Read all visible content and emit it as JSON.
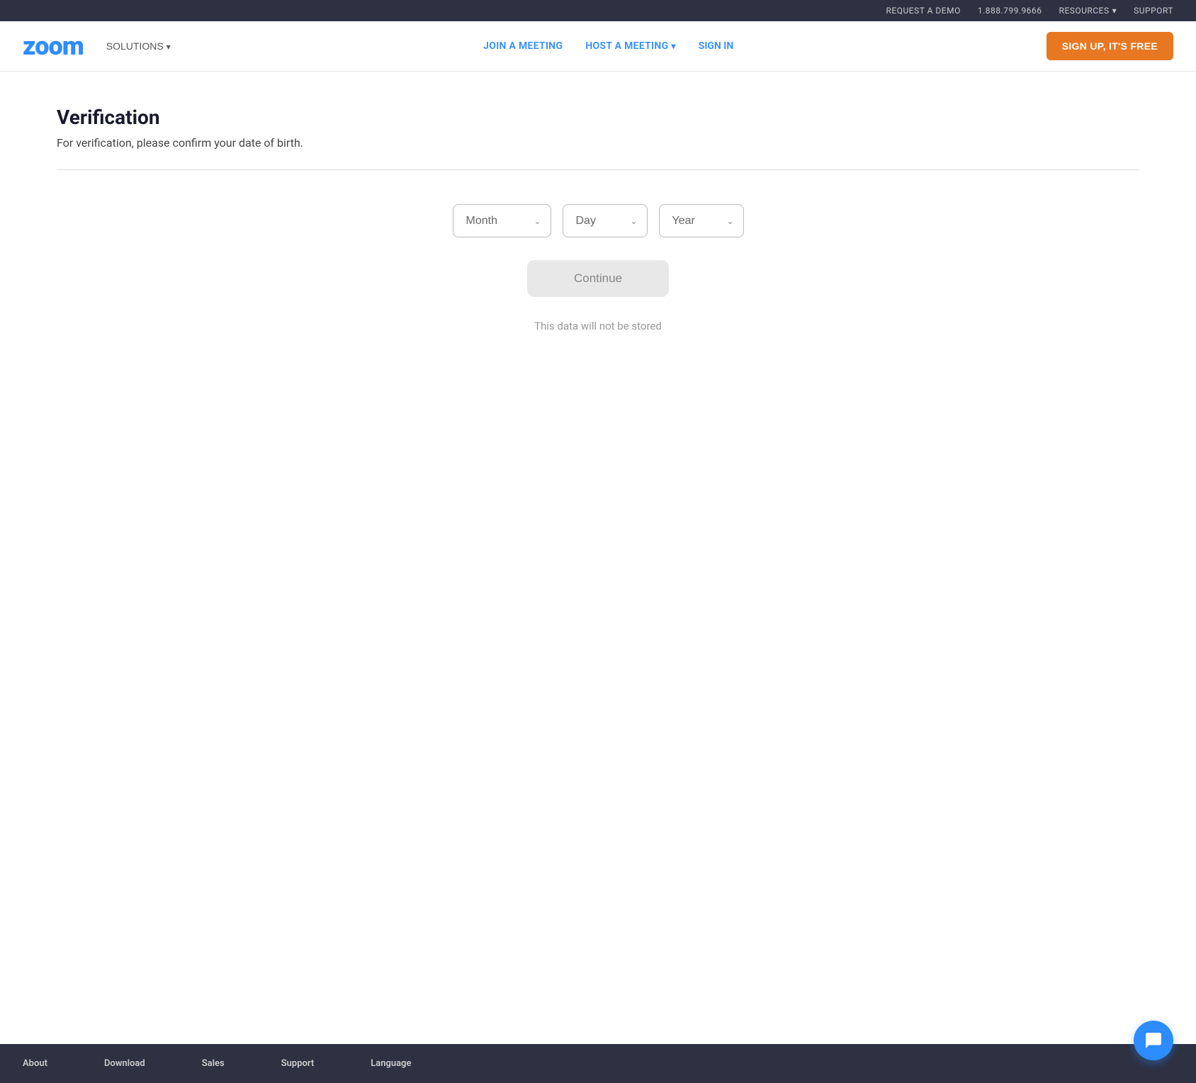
{
  "topBar": {
    "requestDemo": "REQUEST A DEMO",
    "phone": "1.888.799.9666",
    "resources": "RESOURCES",
    "support": "SUPPORT"
  },
  "nav": {
    "logo": "zoom",
    "solutions": "SOLUTIONS",
    "joinMeeting": "JOIN A MEETING",
    "hostMeeting": "HOST A MEETING",
    "signIn": "SIGN IN",
    "signUp": "SIGN UP, IT'S FREE"
  },
  "page": {
    "title": "Verification",
    "subtitle": "For verification, please confirm your date of birth."
  },
  "form": {
    "monthPlaceholder": "Month",
    "dayPlaceholder": "Day",
    "yearPlaceholder": "Year",
    "continueLabel": "Continue",
    "dataNotice": "This data will not be stored"
  },
  "footer": {
    "about": "About",
    "download": "Download",
    "sales": "Sales",
    "support": "Support",
    "language": "Language"
  }
}
